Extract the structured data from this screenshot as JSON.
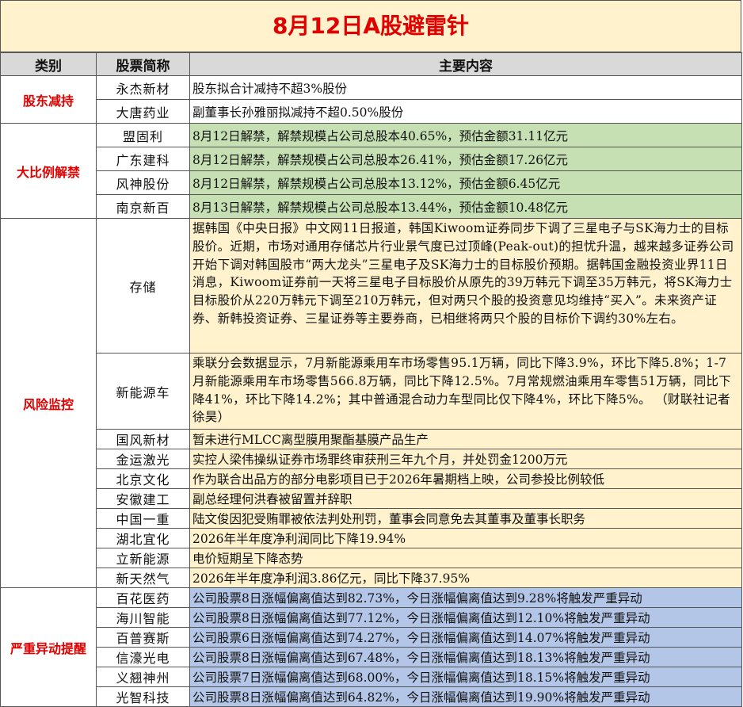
{
  "title": "8月12日A股避雷针",
  "headers": {
    "category": "类别",
    "stock": "股票简称",
    "content": "主要内容"
  },
  "groups": [
    {
      "category": "股东减持",
      "color": "#ffffff",
      "rows": [
        {
          "stock": "永杰新材",
          "content": "股东拟合计减持不超3%股份"
        },
        {
          "stock": "大唐药业",
          "content": "副董事长孙雅丽拟减持不超0.50%股份"
        }
      ]
    },
    {
      "category": "大比例解禁",
      "color": "#c6e0b4",
      "rows": [
        {
          "stock": "盟固利",
          "content": "8月12日解禁，解禁规模占公司总股本40.65%，预估金额31.11亿元"
        },
        {
          "stock": "广东建科",
          "content": "8月12日解禁，解禁规模占公司总股本26.41%，预估金额17.26亿元"
        },
        {
          "stock": "风神股份",
          "content": "8月12日解禁，解禁规模占公司总股本13.12%，预估金额6.45亿元"
        },
        {
          "stock": "南京新百",
          "content": "8月13日解禁，解禁规模占公司总股本13.44%，预估金额10.48亿元"
        }
      ]
    },
    {
      "category": "风险监控",
      "color": "#fff2cc",
      "rows": [
        {
          "stock": "存储",
          "content": "据韩国《中央日报》中文网11日报道，韩国Kiwoom证券同步下调了三星电子与SK海力士的目标股价。近期，市场对通用存储芯片行业景气度已过顶峰(Peak-out)的担忧升温，越来越多证券公司开始下调对韩国股市“两大龙头”三星电子及SK海力士的目标股价预期。据韩国金融投资业界11日消息，Kiwoom证券前一天将三星电子目标股价从原先的39万韩元下调至35万韩元，将SK海力士目标股价从220万韩元下调至210万韩元，但对两只个股的投资意见均维持“买入”。未来资产证券、新韩投资证券、三星证券等主要券商，已相继将两只个股的目标价下调约30%左右。"
        },
        {
          "stock": "新能源车",
          "content": "乘联分会数据显示，7月新能源乘用车市场零售95.1万辆，同比下降3.9%，环比下降5.8%；1-7月新能源乘用车市场零售566.8万辆，同比下降12.5%。7月常规燃油乘用车零售51万辆，同比下降41%，环比下降14.2%；其中普通混合动力车型同比仅下降4%，环比下降5%。 （财联社记者 徐昊）"
        },
        {
          "stock": "国风新材",
          "content": "暂未进行MLCC离型膜用聚酯基膜产品生产"
        },
        {
          "stock": "金运激光",
          "content": "实控人梁伟操纵证券市场罪终审获刑三年九个月，并处罚金1200万元"
        },
        {
          "stock": "北京文化",
          "content": "作为联合出品方的部分电影项目已于2026年暑期档上映，公司参投比例较低"
        },
        {
          "stock": "安徽建工",
          "content": "副总经理何洪春被留置并辞职"
        },
        {
          "stock": "中国一重",
          "content": "陆文俊因犯受贿罪被依法判处刑罚，董事会同意免去其董事及董事长职务"
        },
        {
          "stock": "湖北宜化",
          "content": "2026年半年度净利润同比下降19.94%"
        },
        {
          "stock": "立新能源",
          "content": "电价短期呈下降态势"
        },
        {
          "stock": "新天然气",
          "content": "2026年半年度净利润3.86亿元，同比下降37.95%"
        }
      ]
    },
    {
      "category": "严重异动提醒",
      "color": "#b4c6e7",
      "rows": [
        {
          "stock": "百花医药",
          "content": "公司股票8日涨幅偏离值达到82.73%，今日涨幅偏离值达到9.28%将触发严重异动"
        },
        {
          "stock": "海川智能",
          "content": "公司股票8日涨幅偏离值达到77.12%，今日涨幅偏离值达到12.10%将触发严重异动"
        },
        {
          "stock": "百普赛斯",
          "content": "公司股票6日涨幅偏离值达到74.27%，今日涨幅偏离值达到14.07%将触发严重异动"
        },
        {
          "stock": "信濠光电",
          "content": "公司股票8日涨幅偏离值达到67.48%，今日涨幅偏离值达到18.13%将触发严重异动"
        },
        {
          "stock": "义翘神州",
          "content": "公司股票7日涨幅偏离值达到68.00%，今日涨幅偏离值达到18.15%将触发严重异动"
        },
        {
          "stock": "光智科技",
          "content": "公司股票8日涨幅偏离值达到64.82%，今日涨幅偏离值达到19.90%将触发严重异动"
        }
      ]
    }
  ]
}
